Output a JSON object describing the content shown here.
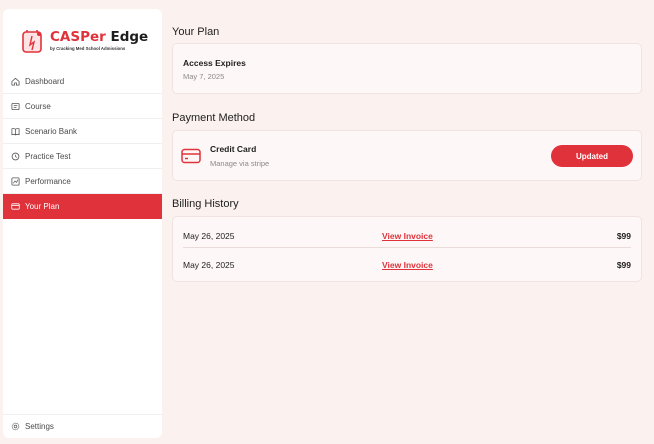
{
  "brand": {
    "title_red": "CASPer",
    "title_dark": "Edge",
    "subtitle": "by Cracking Med School Admissions",
    "accent_color": "#e0323b"
  },
  "sidebar": {
    "items": [
      {
        "label": "Dashboard",
        "icon": "home-icon",
        "active": false
      },
      {
        "label": "Course",
        "icon": "course-icon",
        "active": false
      },
      {
        "label": "Scenario Bank",
        "icon": "book-icon",
        "active": false
      },
      {
        "label": "Practice Test",
        "icon": "clock-icon",
        "active": false
      },
      {
        "label": "Performance",
        "icon": "chart-icon",
        "active": false
      },
      {
        "label": "Your Plan",
        "icon": "card-icon",
        "active": true
      }
    ],
    "settings_label": "Settings"
  },
  "plan": {
    "section_title": "Your Plan",
    "title": "Access Expires",
    "date": "May 7, 2025"
  },
  "payment": {
    "section_title": "Payment Method",
    "title": "Credit Card",
    "subtitle": "Manage via stripe",
    "button_label": "Updated"
  },
  "billing": {
    "section_title": "Billing History",
    "rows": [
      {
        "date": "May 26, 2025",
        "link": "View Invoice",
        "amount": "$99"
      },
      {
        "date": "May 26, 2025",
        "link": "View Invoice",
        "amount": "$99"
      }
    ]
  }
}
